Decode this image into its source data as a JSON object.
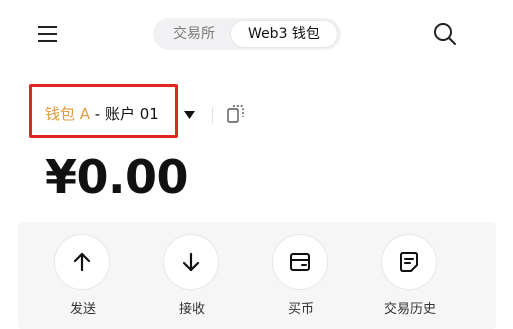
{
  "header": {
    "menu_icon": "hamburger-menu-icon",
    "tabs": [
      {
        "label": "交易所",
        "active": false
      },
      {
        "label": "Web3 钱包",
        "active": true
      }
    ],
    "search_icon": "search-icon"
  },
  "wallet": {
    "name": "钱包 A",
    "separator": " - ",
    "account": "账户 01",
    "name_color": "#e39a3d",
    "highlight_color": "#e0271d"
  },
  "balance": "¥0.00",
  "actions": [
    {
      "label": "发送",
      "icon": "arrow-up-icon"
    },
    {
      "label": "接收",
      "icon": "arrow-down-icon"
    },
    {
      "label": "买币",
      "icon": "card-icon"
    },
    {
      "label": "交易历史",
      "icon": "history-document-icon"
    }
  ]
}
